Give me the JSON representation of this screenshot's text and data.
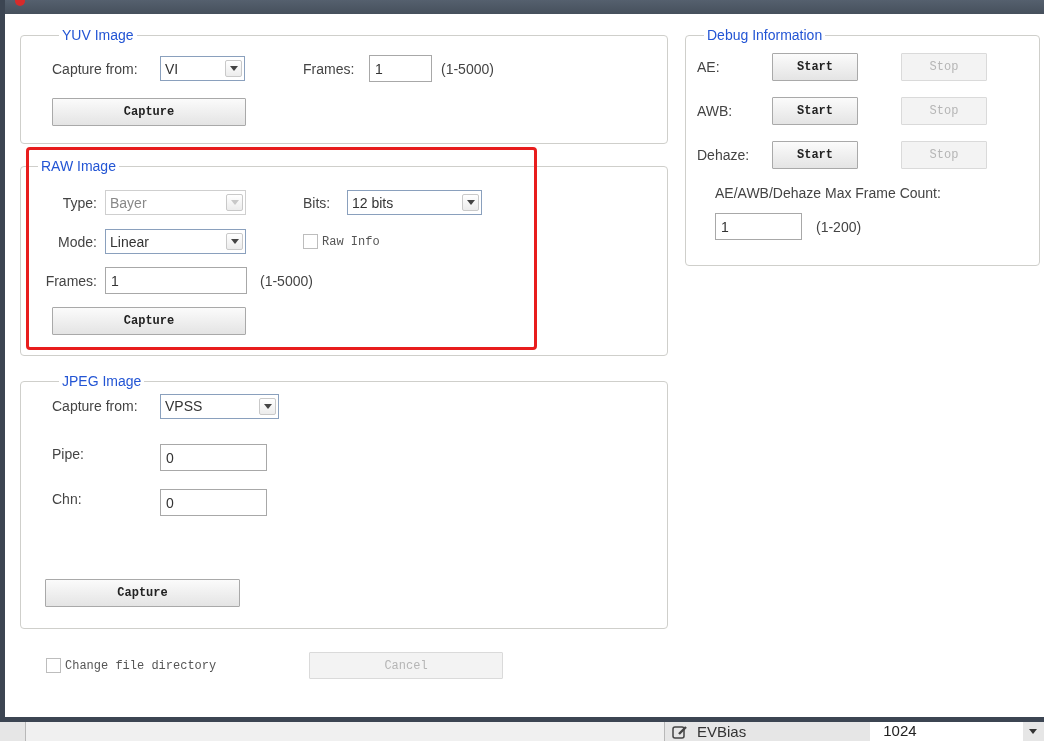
{
  "yuv_image": {
    "title": "YUV Image",
    "capture_from": {
      "label": "Capture from:",
      "value": "VI",
      "disabled": false
    },
    "frames": {
      "label": "Frames:",
      "value": "1",
      "range": "(1-5000)"
    },
    "capture_button": {
      "label": "Capture",
      "disabled": false
    }
  },
  "raw_image": {
    "title": "RAW Image",
    "highlighted": true,
    "type": {
      "label": "Type:",
      "value": "Bayer",
      "disabled": true
    },
    "bits": {
      "label": "Bits:",
      "value": "12 bits",
      "disabled": false
    },
    "mode": {
      "label": "Mode:",
      "value": "Linear",
      "disabled": false
    },
    "raw_info": {
      "label": "Raw Info",
      "checked": false
    },
    "frames": {
      "label": "Frames:",
      "value": "1",
      "range": "(1-5000)"
    },
    "capture_button": {
      "label": "Capture",
      "disabled": false
    }
  },
  "jpeg_image": {
    "title": "JPEG Image",
    "capture_from": {
      "label": "Capture from:",
      "value": "VPSS",
      "disabled": false
    },
    "pipe": {
      "label": "Pipe:",
      "value": "0"
    },
    "chn": {
      "label": "Chn:",
      "value": "0"
    },
    "capture_button": {
      "label": "Capture",
      "disabled": false
    }
  },
  "debug_information": {
    "title": "Debug Information",
    "rows": [
      {
        "label": "AE:",
        "start": {
          "label": "Start",
          "disabled": false
        },
        "stop": {
          "label": "Stop",
          "disabled": true
        }
      },
      {
        "label": "AWB:",
        "start": {
          "label": "Start",
          "disabled": false
        },
        "stop": {
          "label": "Stop",
          "disabled": true
        }
      },
      {
        "label": "Dehaze:",
        "start": {
          "label": "Start",
          "disabled": false
        },
        "stop": {
          "label": "Stop",
          "disabled": true
        }
      }
    ],
    "max_frame_count": {
      "label": "AE/AWB/Dehaze Max Frame Count:",
      "value": "1",
      "range": "(1-200)"
    }
  },
  "change_file_directory": {
    "label": "Change file directory",
    "checked": false
  },
  "cancel_button": {
    "label": "Cancel",
    "disabled": true
  },
  "background_window": {
    "row_label": "EVBias",
    "row_value": "1024"
  }
}
